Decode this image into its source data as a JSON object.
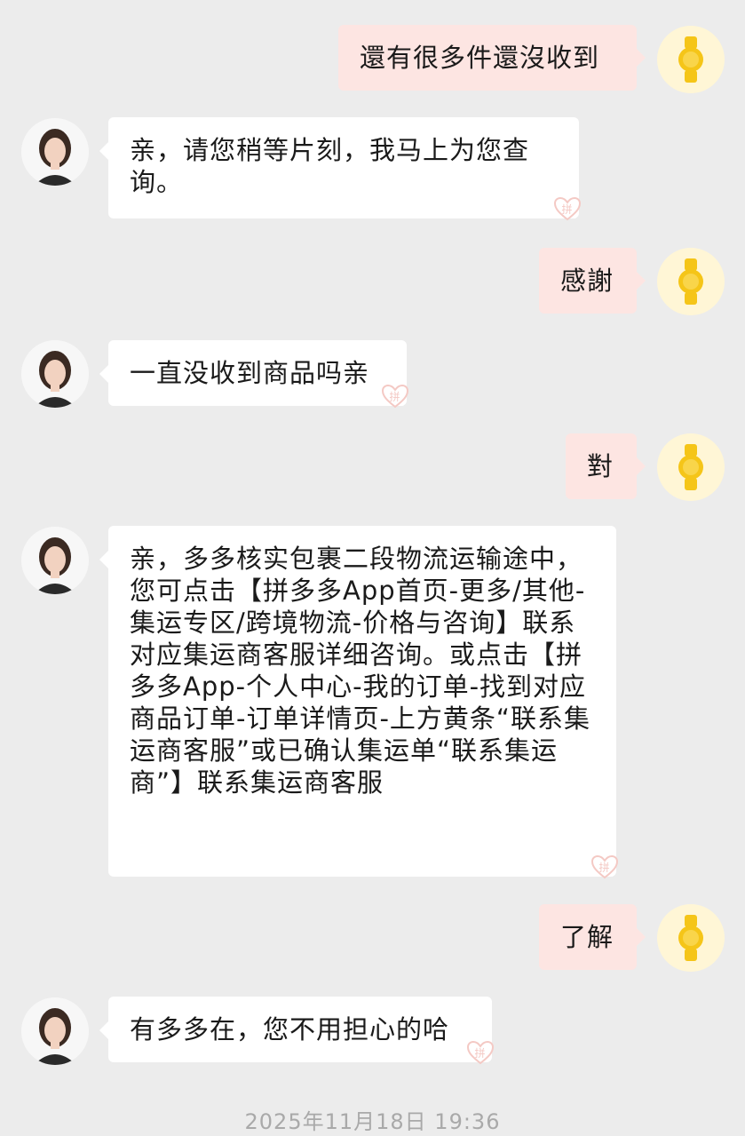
{
  "messages": [
    {
      "sender": "user",
      "text": "還有很多件還沒收到"
    },
    {
      "sender": "agent",
      "text": "亲，请您稍等片刻，我马上为您查询。"
    },
    {
      "sender": "user",
      "text": "感謝"
    },
    {
      "sender": "agent",
      "text": "一直没收到商品吗亲"
    },
    {
      "sender": "user",
      "text": "對"
    },
    {
      "sender": "agent",
      "text": "亲，多多核实包裹二段物流运输途中，您可点击【拼多多App首页-更多/其他-集运专区/跨境物流-价格与咨询】联系对应集运商客服详细咨询。或点击【拼多多App-个人中心-我的订单-找到对应商品订单-订单详情页-上方黄条“联系集运商客服”或已确认集运单“联系集运商”】联系集运商客服"
    },
    {
      "sender": "user",
      "text": "了解"
    },
    {
      "sender": "agent",
      "text": "有多多在，您不用担心的哈"
    }
  ],
  "watermark_text": "拼",
  "timestamp": "2025年11月18日 19:36",
  "colors": {
    "background": "#ececec",
    "outgoing_bubble": "#fde5e2",
    "incoming_bubble": "#ffffff",
    "timestamp": "#a9a9a9",
    "user_avatar_icon": "#f5c518"
  },
  "icons": {
    "user_avatar": "watch-icon",
    "agent_avatar": "agent-avatar-photo",
    "watermark": "pinduoduo-logo-icon"
  }
}
